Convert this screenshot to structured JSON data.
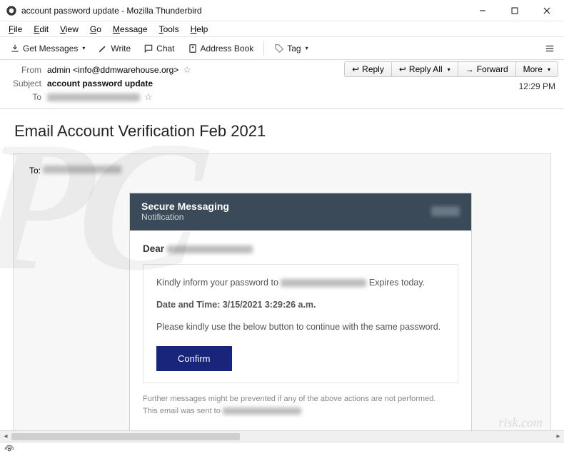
{
  "window": {
    "title": "account password update - Mozilla Thunderbird"
  },
  "menubar": [
    "File",
    "Edit",
    "View",
    "Go",
    "Message",
    "Tools",
    "Help"
  ],
  "toolbar": {
    "get_messages": "Get Messages",
    "write": "Write",
    "chat": "Chat",
    "address_book": "Address Book",
    "tag": "Tag"
  },
  "header": {
    "from_label": "From",
    "from_value": "admin <info@ddmwarehouse.org>",
    "subject_label": "Subject",
    "subject_value": "account password update",
    "to_label": "To",
    "time": "12:29 PM",
    "actions": {
      "reply": "Reply",
      "reply_all": "Reply All",
      "forward": "Forward",
      "more": "More"
    }
  },
  "body": {
    "title": "Email Account Verification Feb 2021",
    "to_label": "To:",
    "card": {
      "h1": "Secure Messaging",
      "h2": "Notification",
      "dear": "Dear",
      "line1a": "Kindly inform your password to",
      "line1b": "Expires today.",
      "datetime_label": "Date and Time:",
      "datetime_value": "3/15/2021 3:29:26 a.m.",
      "line2": "Please kindly use the below button to continue with the same password.",
      "confirm": "Confirm",
      "foot1": "Further messages might be prevented if any of the above actions are not performed.",
      "foot2": "This email was sent to"
    }
  }
}
